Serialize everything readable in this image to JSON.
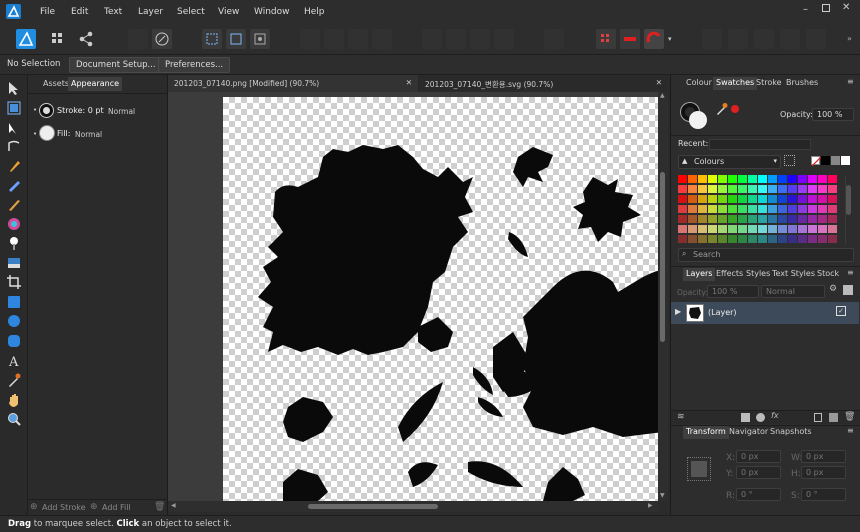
{
  "menu": [
    "File",
    "Edit",
    "Text",
    "Layer",
    "Select",
    "View",
    "Window",
    "Help"
  ],
  "context": {
    "selection": "No Selection",
    "doc_setup": "Document Setup...",
    "preferences": "Preferences..."
  },
  "left_panel": {
    "tabs": [
      "Assets",
      "Appearance"
    ],
    "active_tab": "Appearance",
    "stroke_label": "Stroke: 0 pt",
    "stroke_mode": "Normal",
    "fill_label": "Fill:",
    "fill_mode": "Normal",
    "add_stroke": "Add Stroke",
    "add_fill": "Add Fill"
  },
  "doc_tabs": [
    "201203_07140.png [Modified] (90.7%)",
    "201203_07140_변환용.svg (90.7%)"
  ],
  "right_top": {
    "tabs": [
      "Colour",
      "Swatches",
      "Stroke",
      "Brushes"
    ],
    "active": "Swatches",
    "opacity_label": "Opacity:",
    "opacity_value": "100 %",
    "recent_label": "Recent:",
    "palette": "Colours",
    "search_placeholder": "Search"
  },
  "layers": {
    "tabs": [
      "Layers",
      "Effects",
      "Styles",
      "Text Styles",
      "Stock"
    ],
    "active": "Layers",
    "opacity_label": "Opacity:",
    "opacity_value": "100 %",
    "blend": "Normal",
    "layer_name": "(Layer)"
  },
  "transform": {
    "tabs": [
      "Transform",
      "Navigator",
      "Snapshots"
    ],
    "active": "Transform",
    "x_label": "X:",
    "x": "0 px",
    "y_label": "Y:",
    "y": "0 px",
    "w_label": "W:",
    "w": "0 px",
    "h_label": "H:",
    "h": "0 px",
    "r_label": "R:",
    "r": "0 °",
    "s_label": "S:",
    "s": "0 °"
  },
  "status": {
    "bold1": "Drag",
    "text1": " to marquee select. ",
    "bold2": "Click",
    "text2": " an object to select it."
  },
  "colors": {
    "accent": "#1f8de0",
    "chrome": "#2d2d2d",
    "record": "#e02020"
  }
}
